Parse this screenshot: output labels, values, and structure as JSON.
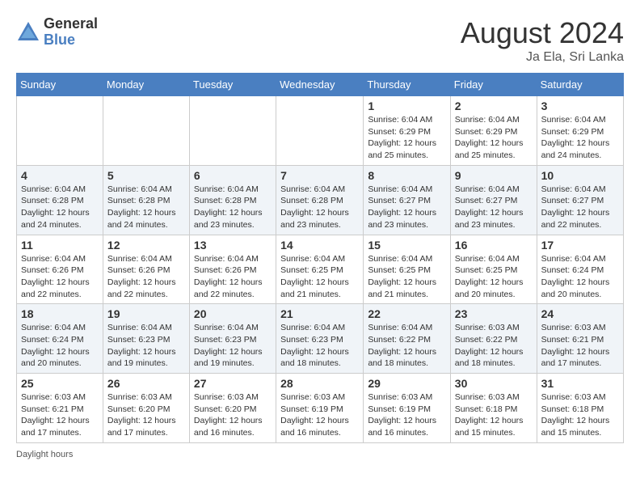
{
  "header": {
    "logo_general": "General",
    "logo_blue": "Blue",
    "month_title": "August 2024",
    "location": "Ja Ela, Sri Lanka"
  },
  "days_of_week": [
    "Sunday",
    "Monday",
    "Tuesday",
    "Wednesday",
    "Thursday",
    "Friday",
    "Saturday"
  ],
  "weeks": [
    [
      {
        "day": "",
        "info": ""
      },
      {
        "day": "",
        "info": ""
      },
      {
        "day": "",
        "info": ""
      },
      {
        "day": "",
        "info": ""
      },
      {
        "day": "1",
        "info": "Sunrise: 6:04 AM\nSunset: 6:29 PM\nDaylight: 12 hours\nand 25 minutes."
      },
      {
        "day": "2",
        "info": "Sunrise: 6:04 AM\nSunset: 6:29 PM\nDaylight: 12 hours\nand 25 minutes."
      },
      {
        "day": "3",
        "info": "Sunrise: 6:04 AM\nSunset: 6:29 PM\nDaylight: 12 hours\nand 24 minutes."
      }
    ],
    [
      {
        "day": "4",
        "info": "Sunrise: 6:04 AM\nSunset: 6:28 PM\nDaylight: 12 hours\nand 24 minutes."
      },
      {
        "day": "5",
        "info": "Sunrise: 6:04 AM\nSunset: 6:28 PM\nDaylight: 12 hours\nand 24 minutes."
      },
      {
        "day": "6",
        "info": "Sunrise: 6:04 AM\nSunset: 6:28 PM\nDaylight: 12 hours\nand 23 minutes."
      },
      {
        "day": "7",
        "info": "Sunrise: 6:04 AM\nSunset: 6:28 PM\nDaylight: 12 hours\nand 23 minutes."
      },
      {
        "day": "8",
        "info": "Sunrise: 6:04 AM\nSunset: 6:27 PM\nDaylight: 12 hours\nand 23 minutes."
      },
      {
        "day": "9",
        "info": "Sunrise: 6:04 AM\nSunset: 6:27 PM\nDaylight: 12 hours\nand 23 minutes."
      },
      {
        "day": "10",
        "info": "Sunrise: 6:04 AM\nSunset: 6:27 PM\nDaylight: 12 hours\nand 22 minutes."
      }
    ],
    [
      {
        "day": "11",
        "info": "Sunrise: 6:04 AM\nSunset: 6:26 PM\nDaylight: 12 hours\nand 22 minutes."
      },
      {
        "day": "12",
        "info": "Sunrise: 6:04 AM\nSunset: 6:26 PM\nDaylight: 12 hours\nand 22 minutes."
      },
      {
        "day": "13",
        "info": "Sunrise: 6:04 AM\nSunset: 6:26 PM\nDaylight: 12 hours\nand 22 minutes."
      },
      {
        "day": "14",
        "info": "Sunrise: 6:04 AM\nSunset: 6:25 PM\nDaylight: 12 hours\nand 21 minutes."
      },
      {
        "day": "15",
        "info": "Sunrise: 6:04 AM\nSunset: 6:25 PM\nDaylight: 12 hours\nand 21 minutes."
      },
      {
        "day": "16",
        "info": "Sunrise: 6:04 AM\nSunset: 6:25 PM\nDaylight: 12 hours\nand 20 minutes."
      },
      {
        "day": "17",
        "info": "Sunrise: 6:04 AM\nSunset: 6:24 PM\nDaylight: 12 hours\nand 20 minutes."
      }
    ],
    [
      {
        "day": "18",
        "info": "Sunrise: 6:04 AM\nSunset: 6:24 PM\nDaylight: 12 hours\nand 20 minutes."
      },
      {
        "day": "19",
        "info": "Sunrise: 6:04 AM\nSunset: 6:23 PM\nDaylight: 12 hours\nand 19 minutes."
      },
      {
        "day": "20",
        "info": "Sunrise: 6:04 AM\nSunset: 6:23 PM\nDaylight: 12 hours\nand 19 minutes."
      },
      {
        "day": "21",
        "info": "Sunrise: 6:04 AM\nSunset: 6:23 PM\nDaylight: 12 hours\nand 18 minutes."
      },
      {
        "day": "22",
        "info": "Sunrise: 6:04 AM\nSunset: 6:22 PM\nDaylight: 12 hours\nand 18 minutes."
      },
      {
        "day": "23",
        "info": "Sunrise: 6:03 AM\nSunset: 6:22 PM\nDaylight: 12 hours\nand 18 minutes."
      },
      {
        "day": "24",
        "info": "Sunrise: 6:03 AM\nSunset: 6:21 PM\nDaylight: 12 hours\nand 17 minutes."
      }
    ],
    [
      {
        "day": "25",
        "info": "Sunrise: 6:03 AM\nSunset: 6:21 PM\nDaylight: 12 hours\nand 17 minutes."
      },
      {
        "day": "26",
        "info": "Sunrise: 6:03 AM\nSunset: 6:20 PM\nDaylight: 12 hours\nand 17 minutes."
      },
      {
        "day": "27",
        "info": "Sunrise: 6:03 AM\nSunset: 6:20 PM\nDaylight: 12 hours\nand 16 minutes."
      },
      {
        "day": "28",
        "info": "Sunrise: 6:03 AM\nSunset: 6:19 PM\nDaylight: 12 hours\nand 16 minutes."
      },
      {
        "day": "29",
        "info": "Sunrise: 6:03 AM\nSunset: 6:19 PM\nDaylight: 12 hours\nand 16 minutes."
      },
      {
        "day": "30",
        "info": "Sunrise: 6:03 AM\nSunset: 6:18 PM\nDaylight: 12 hours\nand 15 minutes."
      },
      {
        "day": "31",
        "info": "Sunrise: 6:03 AM\nSunset: 6:18 PM\nDaylight: 12 hours\nand 15 minutes."
      }
    ]
  ],
  "footer": {
    "note": "Daylight hours"
  }
}
